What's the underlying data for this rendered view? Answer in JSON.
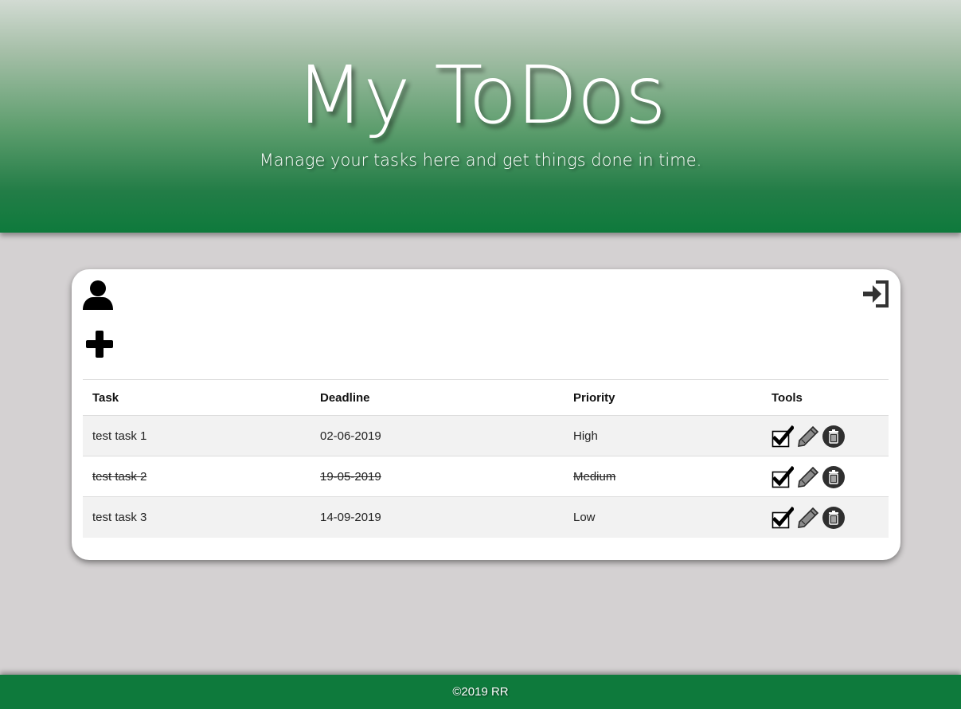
{
  "header": {
    "title": "My ToDos",
    "subtitle": "Manage your tasks here and get things done in time."
  },
  "toolbar": {
    "profile_icon": "user-icon",
    "add_icon": "plus-icon",
    "logout_icon": "sign-in-icon"
  },
  "table": {
    "columns": [
      "Task",
      "Deadline",
      "Priority",
      "Tools"
    ],
    "rows": [
      {
        "task": "test task 1",
        "deadline": "02-06-2019",
        "priority": "High",
        "completed": false
      },
      {
        "task": "test task 2",
        "deadline": "19-05-2019",
        "priority": "Medium",
        "completed": true
      },
      {
        "task": "test task 3",
        "deadline": "14-09-2019",
        "priority": "Low",
        "completed": false
      }
    ],
    "tool_icons": [
      "checkbox-checked-icon",
      "pencil-icon",
      "trash-icon"
    ]
  },
  "footer": {
    "copyright": "©2019 RR"
  },
  "colors": {
    "brand_green": "#0e7a3c",
    "background": "#d4d1d2",
    "card": "#ffffff"
  }
}
